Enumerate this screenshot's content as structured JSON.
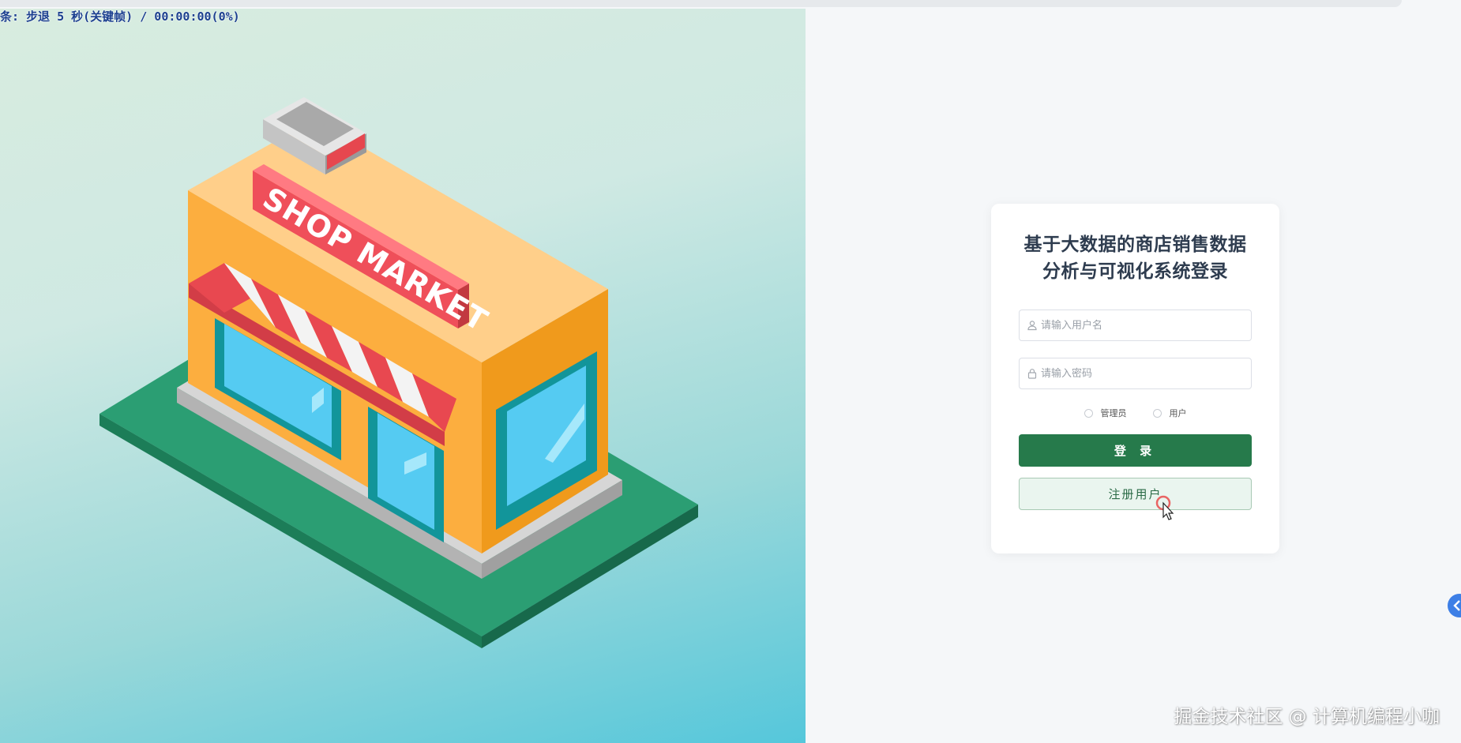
{
  "overlay": {
    "text": "条: 步退 5 秒(关键帧) / 00:00:00(0%)"
  },
  "illustration": {
    "sign_text": "SHOP MARKET"
  },
  "login": {
    "title_line1": "基于大数据的商店销售数据",
    "title_line2": "分析与可视化系统登录",
    "username_placeholder": "请输入用户名",
    "password_placeholder": "请输入密码",
    "role_admin": "管理员",
    "role_user": "用户",
    "login_button": "登 录",
    "register_button": "注册用户"
  },
  "icons": {
    "user": "user-icon",
    "lock": "lock-icon",
    "cursor": "mouse-cursor-icon",
    "collapse": "chevron-left-icon"
  },
  "colors": {
    "primary_green": "#267a4b",
    "register_bg": "#eaf5ef",
    "title": "#2e3c4f",
    "toggle_blue": "#3d7fe6"
  },
  "watermark": {
    "text": "掘金技术社区 @ 计算机编程小咖"
  }
}
